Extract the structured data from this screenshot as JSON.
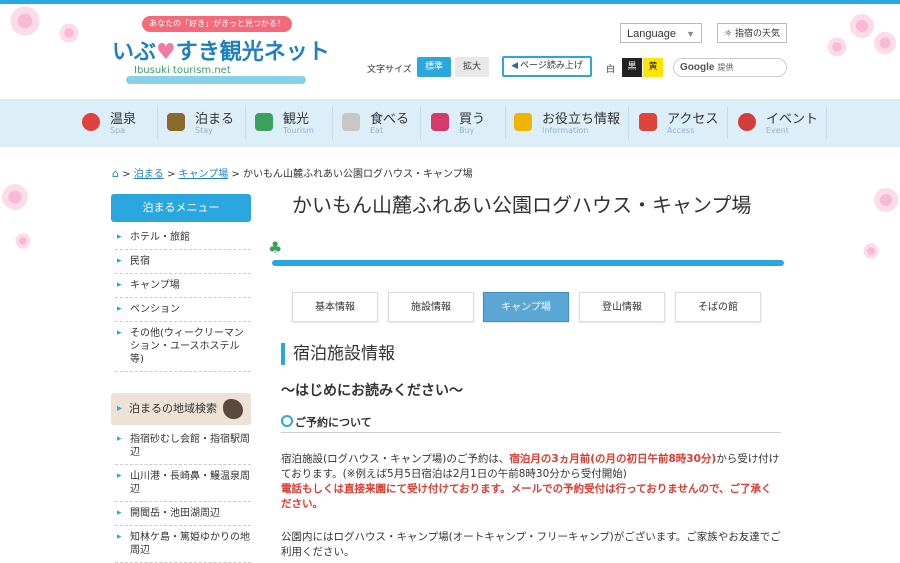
{
  "header": {
    "logo_tagline": "あなたの「好き」がきっと見つかる！",
    "logo_title_part1": "いぶ",
    "logo_title_part2": "すき観光ネット",
    "logo_sub": "Ibusuki tourism.net",
    "language_label": "Language",
    "weather_label": "指宿の天気",
    "font_size_label": "文字サイズ",
    "font_standard": "標準",
    "font_large": "拡大",
    "read_aloud": "ページ読み上げ",
    "color_white": "白",
    "color_black": "黒",
    "color_yellow": "黄",
    "search_brand": "Google",
    "search_placeholder": "提供"
  },
  "nav": [
    {
      "label": "温泉",
      "en": "Spa",
      "icon": "onsen-icon",
      "color": "#e0433b"
    },
    {
      "label": "泊まる",
      "en": "Stay",
      "icon": "bed-icon",
      "color": "#8a6a2a"
    },
    {
      "label": "観光",
      "en": "Tourism",
      "icon": "flag-icon",
      "color": "#3aa05b"
    },
    {
      "label": "食べる",
      "en": "Eat",
      "icon": "cutlery-icon",
      "color": "#9a9a9a"
    },
    {
      "label": "買う",
      "en": "Buy",
      "icon": "cart-icon",
      "color": "#d43b6a"
    },
    {
      "label": "お役立ち情報",
      "en": "Information",
      "icon": "info-icon",
      "color": "#f0b400"
    },
    {
      "label": "アクセス",
      "en": "Access",
      "icon": "car-icon",
      "color": "#e0433b"
    },
    {
      "label": "イベント",
      "en": "Event",
      "icon": "event-icon",
      "color": "#d43b3b"
    }
  ],
  "breadcrumb": {
    "sep": ">",
    "link1": "泊まる",
    "link2": "キャンプ場",
    "current": "かいもん山麓ふれあい公園ログハウス・キャンプ場"
  },
  "sidebar": {
    "menu_title": "泊まるメニュー",
    "items": [
      "ホテル・旅館",
      "民宿",
      "キャンプ場",
      "ペンション",
      "その他(ウィークリーマンション・ユースホステル等)"
    ],
    "area_title": "泊まるの地域検索",
    "areas": [
      "指宿砂むし会館・指宿駅周辺",
      "山川港・長崎鼻・鰻温泉周辺",
      "開聞岳・池田湖周辺",
      "知林ケ島・篤姫ゆかりの地周辺"
    ]
  },
  "main": {
    "title": "かいもん山麓ふれあい公園ログハウス・キャンプ場",
    "tabs": [
      "基本情報",
      "施設情報",
      "キャンプ場",
      "登山情報",
      "そばの館"
    ],
    "active_tab": "キャンプ場",
    "section_title": "宿泊施設情報",
    "sub_title": "〜はじめにお読みください〜",
    "reserve_title": "ご予約について",
    "para1_a": "宿泊施設(ログハウス・キャンプ場)のご予約は、",
    "para1_red": "宿泊月の3ヵ月前(の月の初日午前8時30分)",
    "para1_b": "から受け付けております。(※例えば5月5日宿泊は2月1日の午前8時30分から受付開始)",
    "para1_red2": "電話もしくは直接来園にて受け付けております。メールでの予約受付は行っておりませんので、ご了承ください。",
    "para2": "公園内にはログハウス・キャンプ場(オートキャンプ・フリーキャンプ)がございます。ご家族やお友達でご利用ください。"
  },
  "colors": {
    "accent": "#2aa7df",
    "nav_bg": "#dceef8",
    "red_text": "#e03a2f",
    "active_tab": "#5aa6d4"
  }
}
